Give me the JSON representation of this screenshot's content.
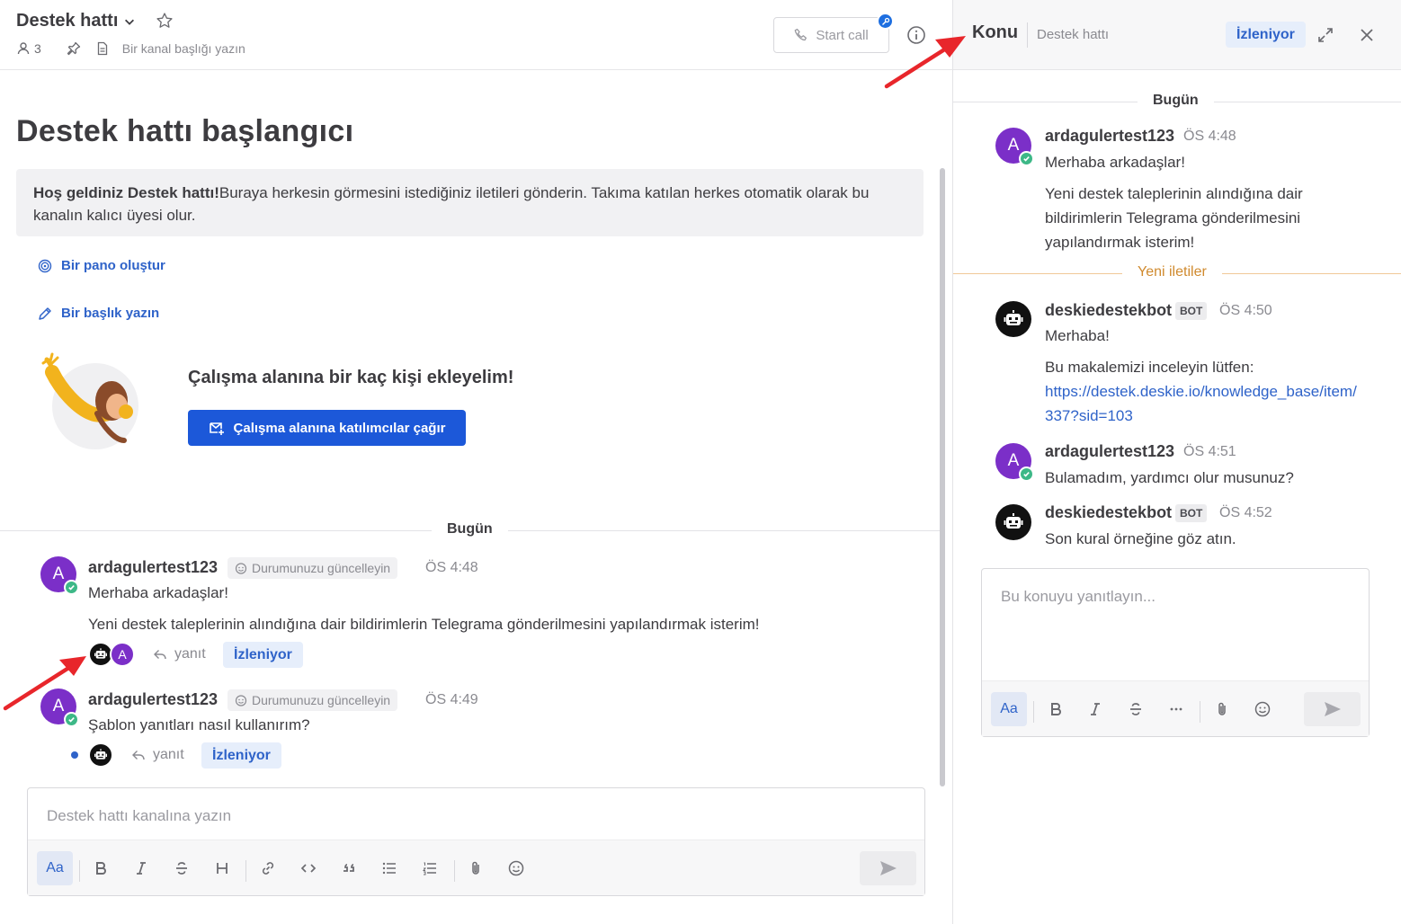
{
  "channel": {
    "title": "Destek hattı",
    "member_count": "3",
    "header_placeholder": "Bir kanal başlığı yazın",
    "start_call": "Start call"
  },
  "intro": {
    "title": "Destek hattı başlangıcı",
    "welcome_bold": "Hoş geldiniz Destek hattı!",
    "welcome_text": "Buraya herkesin görmesini istediğiniz iletileri gönderin. Takıma katılan herkes otomatik olarak bu kanalın kalıcı üyesi olur.",
    "create_board": "Bir pano oluştur",
    "write_header": "Bir başlık yazın",
    "invite_title": "Çalışma alanına bir kaç kişi ekleyelim!",
    "invite_button": "Çalışma alanına katılımcılar çağır"
  },
  "day_label": "Bugün",
  "posts": [
    {
      "avatar_letter": "A",
      "username": "ardagulertest123",
      "status": "Durumunuzu güncelleyin",
      "time": "ÖS 4:48",
      "lines": [
        "Merhaba arkadaşlar!",
        "Yeni destek taleplerinin alındığına dair bildirimlerin Telegrama gönderilmesini yapılandırmak isterim!"
      ],
      "reply": "yanıt",
      "follow": "İzleniyor"
    },
    {
      "avatar_letter": "A",
      "username": "ardagulertest123",
      "status": "Durumunuzu güncelleyin",
      "time": "ÖS 4:49",
      "lines": [
        "Şablon yanıtları nasıl kullanırım?"
      ],
      "reply": "yanıt",
      "follow": "İzleniyor"
    }
  ],
  "composer": {
    "placeholder": "Destek hattı kanalına yazın",
    "format_label": "Aa"
  },
  "thread": {
    "title": "Konu",
    "channel": "Destek hattı",
    "follow": "İzleniyor",
    "day_label": "Bugün",
    "new_messages": "Yeni iletiler",
    "bot_badge": "BOT",
    "messages": [
      {
        "avatar_letter": "A",
        "username": "ardagulertest123",
        "time": "ÖS 4:48",
        "lines": [
          "Merhaba arkadaşlar!",
          "Yeni destek taleplerinin alındığına dair",
          "bildirimlerin Telegrama gönderilmesini",
          "yapılandırmak isterim!"
        ]
      },
      {
        "username": "deskiedestekbot",
        "time": "ÖS 4:50",
        "lines": [
          "Merhaba!",
          "Bu makalemizi inceleyin lütfen:"
        ],
        "link_lines": [
          "https://destek.deskie.io/knowledge_base/item/",
          "337?sid=103"
        ]
      },
      {
        "avatar_letter": "A",
        "username": "ardagulertest123",
        "time": "ÖS 4:51",
        "lines": [
          "Bulamadım, yardımcı olur musunuz?"
        ]
      },
      {
        "username": "deskiedestekbot",
        "time": "ÖS 4:52",
        "lines": [
          "Son kural örneğine göz atın."
        ]
      }
    ],
    "reply_placeholder": "Bu konuyu yanıtlayın...",
    "format_label": "Aa"
  },
  "colors": {
    "accent": "#1c58d9",
    "avatar": "#7b2fc8",
    "online": "#3db887",
    "new_messages": "#d08a2e",
    "annotation_arrow": "#e8262b"
  }
}
